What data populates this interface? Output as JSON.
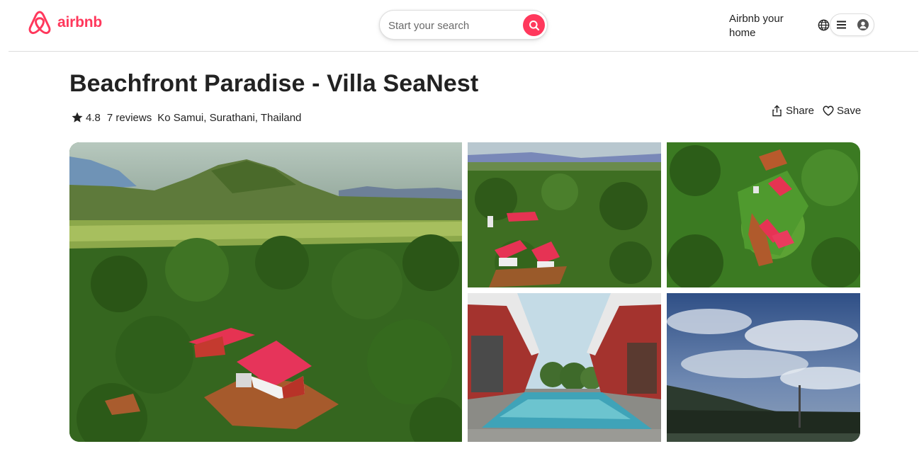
{
  "header": {
    "brand": "airbnb",
    "search": {
      "placeholder": "Start your search"
    },
    "host_link": "Airbnb your home",
    "icons": {
      "logo": "airbnb-belo-icon",
      "search": "search-icon",
      "globe": "globe-icon",
      "menu": "menu-icon",
      "avatar": "user-avatar-icon"
    }
  },
  "listing": {
    "title": "Beachfront Paradise - Villa SeaNest",
    "rating": "4.8",
    "reviews": "7 reviews",
    "location": "Ko Samui, Surathani, Thailand",
    "actions": {
      "share": "Share",
      "save": "Save"
    }
  },
  "colors": {
    "brand": "#ff385c",
    "text": "#222222",
    "border": "#dddddd"
  },
  "gallery": [
    {
      "id": "main",
      "description_icon": "aerial-villa-photo"
    },
    {
      "id": "top-middle",
      "description_icon": "aerial-houses-photo"
    },
    {
      "id": "top-right",
      "description_icon": "top-down-aerial-photo"
    },
    {
      "id": "bottom-middle",
      "description_icon": "pool-photo"
    },
    {
      "id": "bottom-right",
      "description_icon": "sky-photo"
    }
  ]
}
